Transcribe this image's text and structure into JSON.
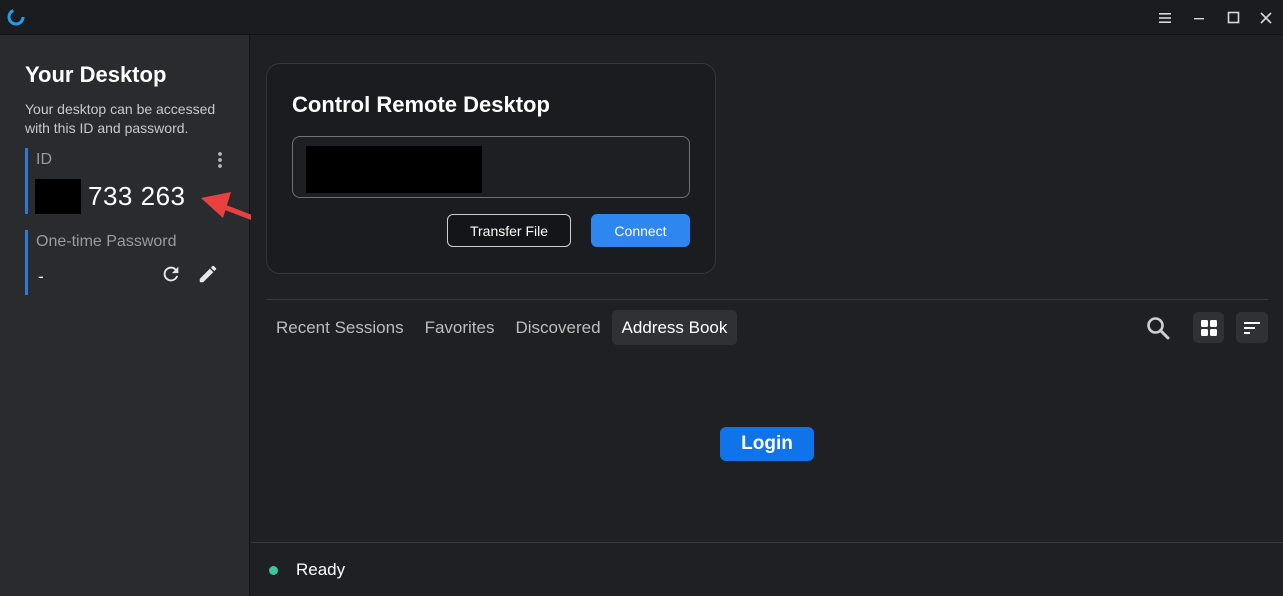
{
  "titlebar": {
    "icons": [
      "app-logo-icon",
      "menu-icon",
      "minimize-icon",
      "maximize-icon",
      "close-icon"
    ]
  },
  "sidebar": {
    "title": "Your Desktop",
    "description": "Your desktop can be accessed with this ID and password.",
    "id_label": "ID",
    "id_value": "733 263",
    "password_label": "One-time Password",
    "password_value": "-"
  },
  "control": {
    "title": "Control Remote Desktop",
    "transfer_label": "Transfer File",
    "connect_label": "Connect"
  },
  "tabs": [
    {
      "label": "Recent Sessions",
      "active": false
    },
    {
      "label": "Favorites",
      "active": false
    },
    {
      "label": "Discovered",
      "active": false
    },
    {
      "label": "Address Book",
      "active": true
    }
  ],
  "address_book": {
    "login_label": "Login"
  },
  "status": {
    "text": "Ready",
    "color": "#3cc79b"
  },
  "colors": {
    "accent": "#2e86f0",
    "annotation": "#e8413f"
  }
}
